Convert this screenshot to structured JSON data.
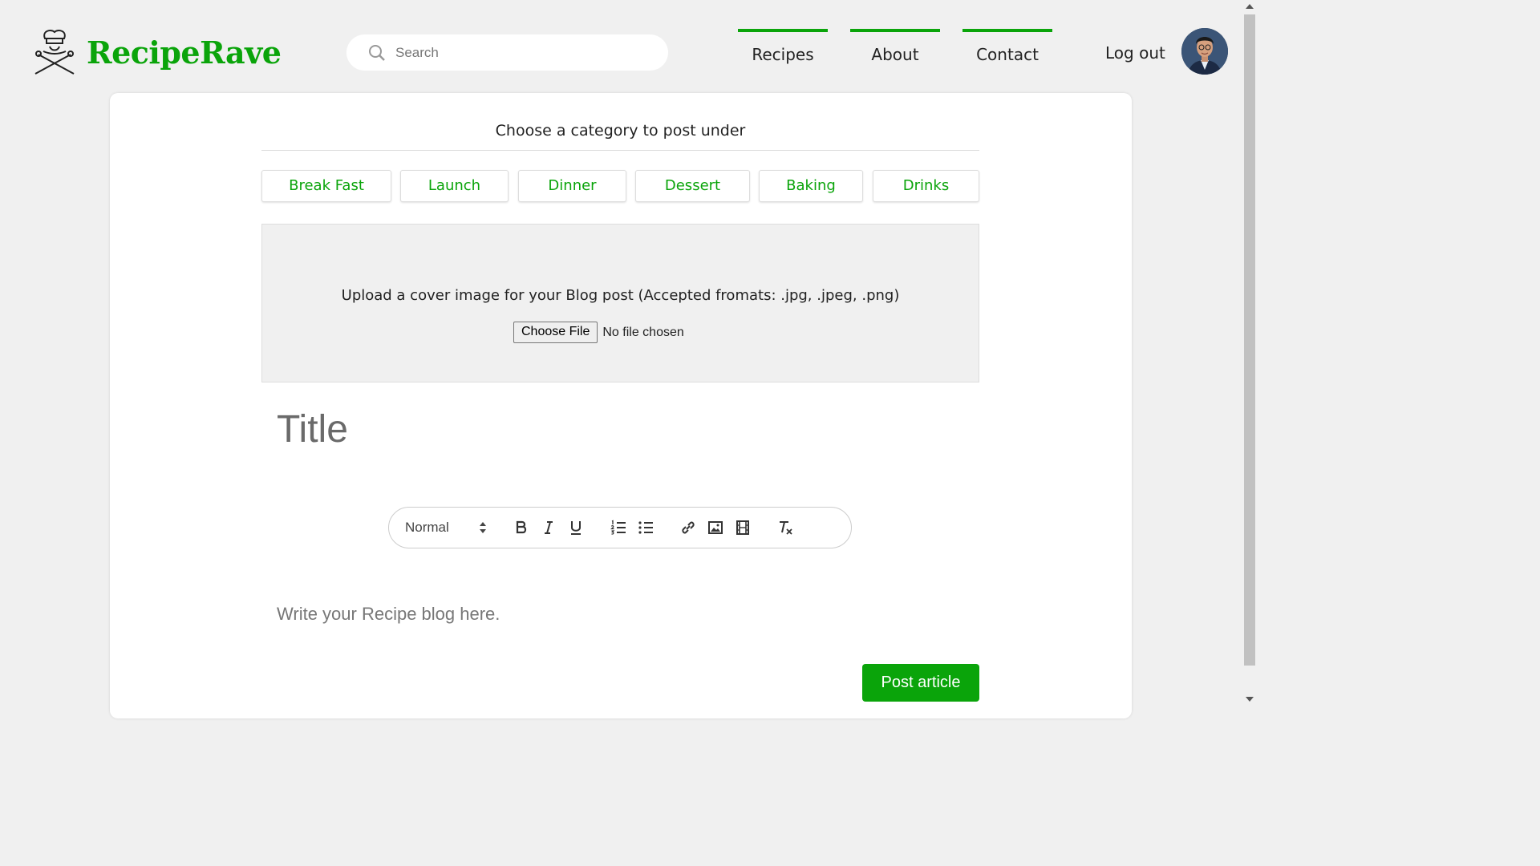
{
  "brand": {
    "name": "RecipeRave"
  },
  "search": {
    "placeholder": "Search"
  },
  "nav": {
    "items": [
      "Recipes",
      "About",
      "Contact"
    ],
    "logout_label": "Log out"
  },
  "colors": {
    "accent": "#0aa40a",
    "background": "#f0f0f0",
    "card": "#ffffff"
  },
  "form": {
    "category_heading": "Choose a category to post under",
    "categories": [
      "Break Fast",
      "Launch",
      "Dinner",
      "Dessert",
      "Baking",
      "Drinks"
    ],
    "upload_text": "Upload a cover image for your Blog post (Accepted fromats: .jpg, .jpeg, .png)",
    "choose_file_label": "Choose File",
    "file_status": "No file chosen",
    "title_placeholder": "Title",
    "editor": {
      "format_value": "Normal",
      "toolbar_icons": [
        "bold-icon",
        "italic-icon",
        "underline-icon",
        "ordered-list-icon",
        "bullet-list-icon",
        "link-icon",
        "image-icon",
        "video-icon",
        "clear-format-icon"
      ],
      "placeholder": "Write your Recipe blog here."
    },
    "submit_label": "Post article"
  }
}
